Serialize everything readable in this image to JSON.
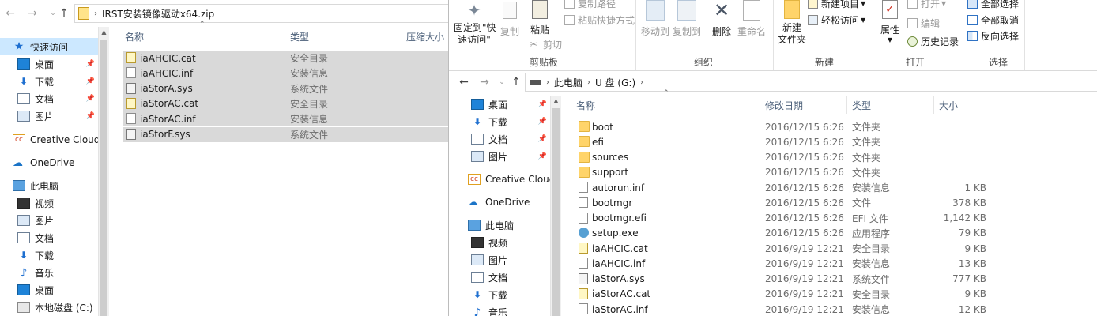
{
  "left": {
    "address": "IRST安装镜像驱动x64.zip",
    "columns": {
      "name": "名称",
      "type": "类型",
      "compressed": "压缩大小"
    },
    "nav": [
      {
        "label": "快速访问",
        "icon": "star-icon",
        "selected": true
      },
      {
        "label": "桌面",
        "icon": "desktop-icon",
        "pin": true
      },
      {
        "label": "下载",
        "icon": "download-icon",
        "pin": true
      },
      {
        "label": "文档",
        "icon": "documents-icon",
        "pin": true
      },
      {
        "label": "图片",
        "icon": "pictures-icon",
        "pin": true
      },
      {
        "label": "Creative Cloud F",
        "icon": "creative-cloud-icon"
      },
      {
        "label": "OneDrive",
        "icon": "onedrive-icon"
      },
      {
        "label": "此电脑",
        "icon": "this-pc-icon"
      },
      {
        "label": "视频",
        "icon": "videos-icon"
      },
      {
        "label": "图片",
        "icon": "pictures-icon"
      },
      {
        "label": "文档",
        "icon": "documents-icon"
      },
      {
        "label": "下载",
        "icon": "download-icon"
      },
      {
        "label": "音乐",
        "icon": "music-icon"
      },
      {
        "label": "桌面",
        "icon": "desktop-icon"
      },
      {
        "label": "本地磁盘 (C:)",
        "icon": "drive-icon"
      }
    ],
    "files": [
      {
        "name": "iaAHCIC.cat",
        "type": "安全目录"
      },
      {
        "name": "iaAHCIC.inf",
        "type": "安装信息"
      },
      {
        "name": "iaStorA.sys",
        "type": "系统文件"
      },
      {
        "name": "iaStorAC.cat",
        "type": "安全目录"
      },
      {
        "name": "iaStorAC.inf",
        "type": "安装信息"
      },
      {
        "name": "iaStorF.sys",
        "type": "系统文件"
      }
    ]
  },
  "right": {
    "ribbon": {
      "pin": "固定到\"快\n速访问\"",
      "copy": "复制",
      "paste": "粘贴",
      "copy_path": "复制路径",
      "paste_shortcut": "粘贴快捷方式",
      "cut": "剪切",
      "clipboard": "剪贴板",
      "move_to": "移动到",
      "copy_to": "复制到",
      "delete": "删除",
      "rename": "重命名",
      "organize": "组织",
      "new_folder": "新建\n文件夹",
      "new_item": "新建项目",
      "easy_access": "轻松访问",
      "new": "新建",
      "properties": "属性",
      "open": "打开",
      "edit": "编辑",
      "history": "历史记录",
      "open_group": "打开",
      "select_all": "全部选择",
      "select_none": "全部取消",
      "invert": "反向选择",
      "select_group": "选择"
    },
    "crumbs": [
      "此电脑",
      "U 盘 (G:)"
    ],
    "columns": {
      "name": "名称",
      "date": "修改日期",
      "type": "类型",
      "size": "大小"
    },
    "nav": [
      {
        "label": "桌面",
        "icon": "desktop-icon",
        "pin": true
      },
      {
        "label": "下载",
        "icon": "download-icon",
        "pin": true
      },
      {
        "label": "文档",
        "icon": "documents-icon",
        "pin": true
      },
      {
        "label": "图片",
        "icon": "pictures-icon",
        "pin": true
      },
      {
        "label": "Creative Cloud F",
        "icon": "creative-cloud-icon"
      },
      {
        "label": "OneDrive",
        "icon": "onedrive-icon"
      },
      {
        "label": "此电脑",
        "icon": "this-pc-icon"
      },
      {
        "label": "视频",
        "icon": "videos-icon"
      },
      {
        "label": "图片",
        "icon": "pictures-icon"
      },
      {
        "label": "文档",
        "icon": "documents-icon"
      },
      {
        "label": "下载",
        "icon": "download-icon"
      },
      {
        "label": "音乐",
        "icon": "music-icon"
      }
    ],
    "files": [
      {
        "name": "boot",
        "date": "2016/12/15 6:26",
        "type": "文件夹",
        "size": "",
        "icon": "folder-icon"
      },
      {
        "name": "efi",
        "date": "2016/12/15 6:26",
        "type": "文件夹",
        "size": "",
        "icon": "folder-icon"
      },
      {
        "name": "sources",
        "date": "2016/12/15 6:26",
        "type": "文件夹",
        "size": "",
        "icon": "folder-icon"
      },
      {
        "name": "support",
        "date": "2016/12/15 6:26",
        "type": "文件夹",
        "size": "",
        "icon": "folder-icon"
      },
      {
        "name": "autorun.inf",
        "date": "2016/12/15 6:26",
        "type": "安装信息",
        "size": "1 KB",
        "icon": "inf-file-icon"
      },
      {
        "name": "bootmgr",
        "date": "2016/12/15 6:26",
        "type": "文件",
        "size": "378 KB",
        "icon": "file-icon"
      },
      {
        "name": "bootmgr.efi",
        "date": "2016/12/15 6:26",
        "type": "EFI 文件",
        "size": "1,142 KB",
        "icon": "file-icon"
      },
      {
        "name": "setup.exe",
        "date": "2016/12/15 6:26",
        "type": "应用程序",
        "size": "79 KB",
        "icon": "setup-exe-icon"
      },
      {
        "name": "iaAHCIC.cat",
        "date": "2016/9/19 12:21",
        "type": "安全目录",
        "size": "9 KB",
        "icon": "catalog-file-icon"
      },
      {
        "name": "iaAHCIC.inf",
        "date": "2016/9/19 12:21",
        "type": "安装信息",
        "size": "13 KB",
        "icon": "inf-file-icon"
      },
      {
        "name": "iaStorA.sys",
        "date": "2016/9/19 12:21",
        "type": "系统文件",
        "size": "777 KB",
        "icon": "sys-file-icon"
      },
      {
        "name": "iaStorAC.cat",
        "date": "2016/9/19 12:21",
        "type": "安全目录",
        "size": "9 KB",
        "icon": "catalog-file-icon"
      },
      {
        "name": "iaStorAC.inf",
        "date": "2016/9/19 12:21",
        "type": "安装信息",
        "size": "12 KB",
        "icon": "inf-file-icon"
      }
    ]
  }
}
